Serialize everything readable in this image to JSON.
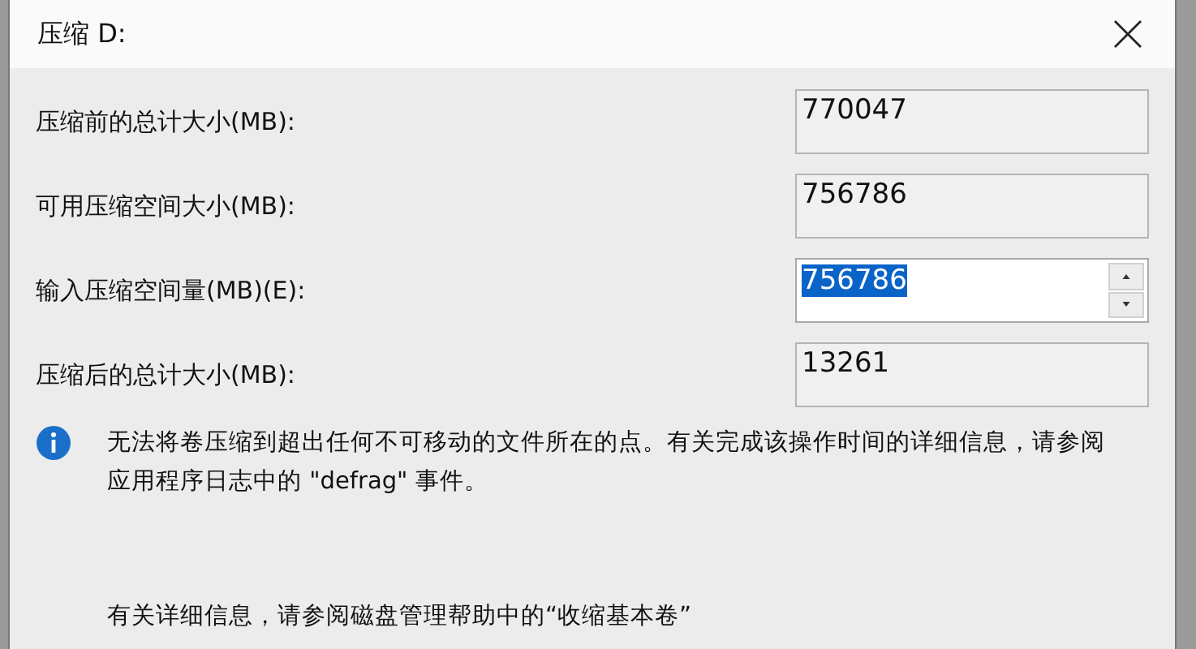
{
  "window": {
    "title": "压缩 D:"
  },
  "fields": [
    {
      "label": "压缩前的总计大小(MB):",
      "value": "770047",
      "kind": "readonly",
      "text_selected": false
    },
    {
      "label": "可用压缩空间大小(MB):",
      "value": "756786",
      "kind": "readonly",
      "text_selected": false
    },
    {
      "label": "输入压缩空间量(MB)(E):",
      "value": "756786",
      "kind": "spin",
      "text_selected": true
    },
    {
      "label": "压缩后的总计大小(MB):",
      "value": "13261",
      "kind": "readonly",
      "text_selected": false
    }
  ],
  "info": {
    "message": "无法将卷压缩到超出任何不可移动的文件所在的点。有关完成该操作时间的详细信息，请参阅应用程序日志中的 \"defrag\" 事件。"
  },
  "help": "有关详细信息，请参阅磁盘管理帮助中的“收缩基本卷”"
}
